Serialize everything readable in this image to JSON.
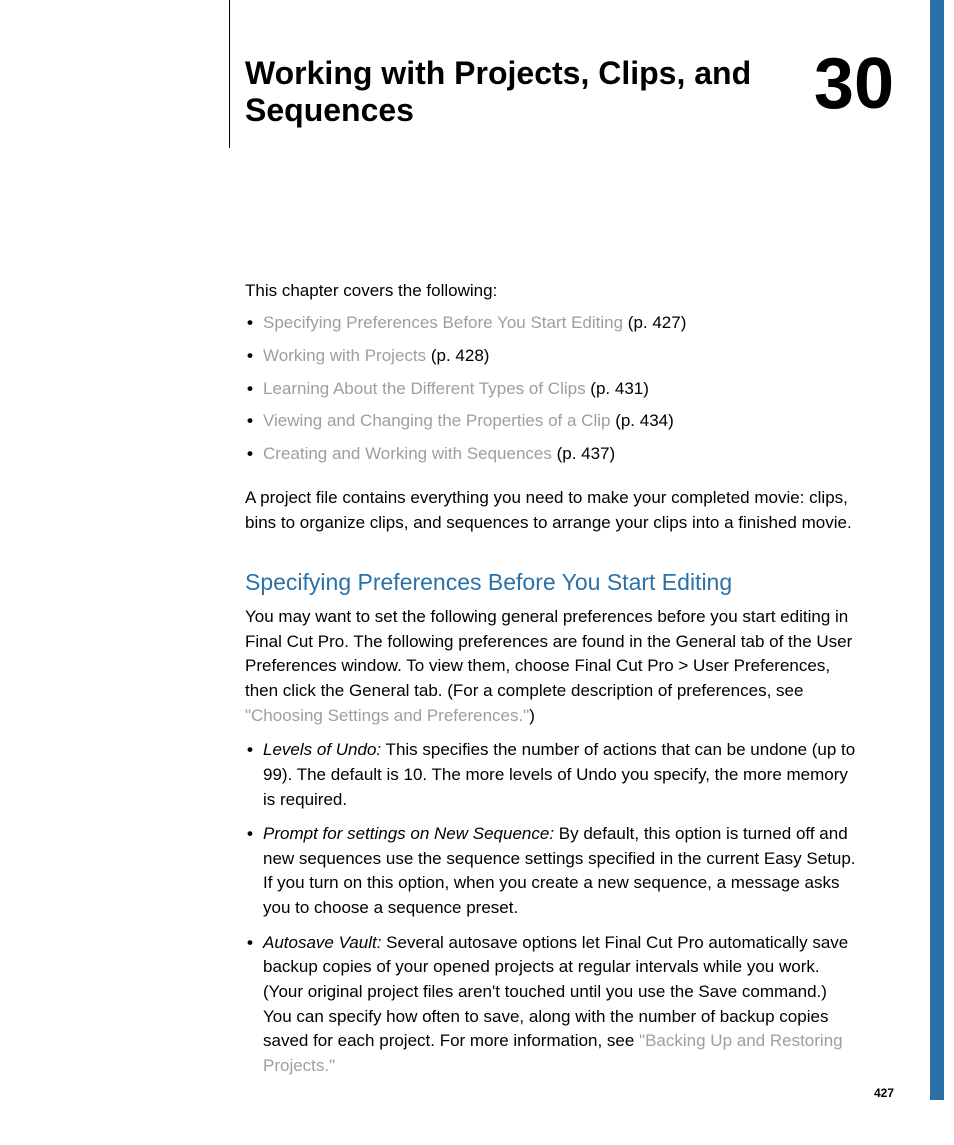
{
  "chapter": {
    "title": "Working with Projects, Clips, and Sequences",
    "number": "30"
  },
  "intro": "This chapter covers the following:",
  "toc": [
    {
      "link": "Specifying Preferences Before You Start Editing",
      "page": " (p. 427)"
    },
    {
      "link": "Working with Projects",
      "page": " (p. 428)"
    },
    {
      "link": "Learning About the Different Types of Clips",
      "page": " (p. 431)"
    },
    {
      "link": "Viewing and Changing the Properties of a Clip",
      "page": " (p. 434)"
    },
    {
      "link": "Creating and Working with Sequences",
      "page": " (p. 437)"
    }
  ],
  "overview": "A project file contains everything you need to make your completed movie: clips, bins to organize clips, and sequences to arrange your clips into a finished movie.",
  "section": {
    "heading": "Specifying Preferences Before You Start Editing",
    "body_before_link": "You may want to set the following general preferences before you start editing in Final Cut Pro. The following preferences are found in the General tab of the User Preferences window. To view them, choose Final Cut Pro > User Preferences, then click the General tab. (For a complete description of preferences, see ",
    "body_link": "\"Choosing Settings and Preferences.\"",
    "body_after_link": ")",
    "bullets": [
      {
        "term": "Levels of Undo:",
        "text": "  This specifies the number of actions that can be undone (up to 99). The default is 10. The more levels of Undo you specify, the more memory is required."
      },
      {
        "term": "Prompt for settings on New Sequence:",
        "text": "  By default, this option is turned off and new sequences use the sequence settings specified in the current Easy Setup. If you turn on this option, when you create a new sequence, a message asks you to choose a sequence preset."
      },
      {
        "term": "Autosave Vault:",
        "text": "  Several autosave options let Final Cut Pro automatically save backup copies of your opened projects at regular intervals while you work. (Your original project files aren't touched until you use the Save command.) You can specify how often to save, along with the number of backup copies saved for each project. For more information, see ",
        "trailing_link": "\"Backing Up and Restoring Projects.\""
      }
    ]
  },
  "page_number": "427"
}
